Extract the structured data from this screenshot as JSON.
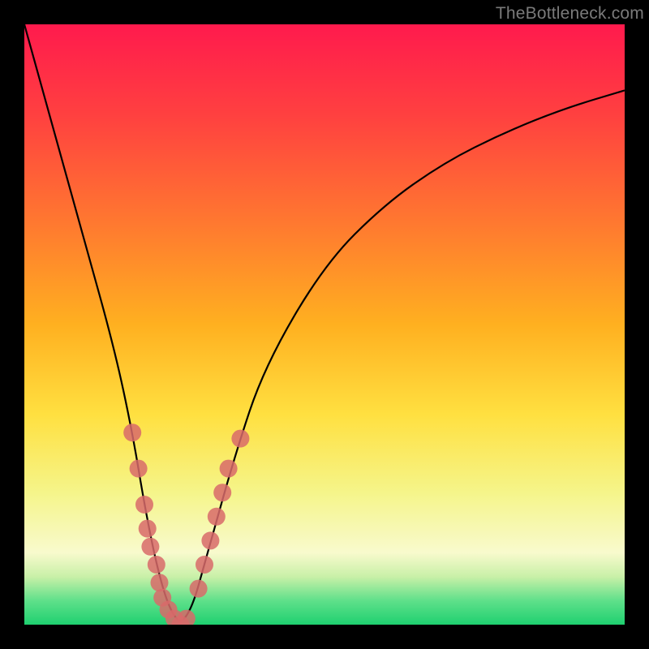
{
  "watermark": "TheBottleneck.com",
  "chart_data": {
    "type": "line",
    "title": "",
    "xlabel": "",
    "ylabel": "",
    "xlim": [
      0,
      100
    ],
    "ylim": [
      0,
      100
    ],
    "grid": false,
    "series": [
      {
        "name": "bottleneck-curve",
        "x": [
          0,
          5,
          10,
          15,
          18,
          20,
          22,
          24,
          26,
          28,
          30,
          35,
          40,
          50,
          60,
          70,
          80,
          90,
          100
        ],
        "values": [
          100,
          82,
          64,
          46,
          32,
          20,
          10,
          3,
          0,
          3,
          10,
          28,
          43,
          60,
          70,
          77,
          82,
          86,
          89
        ]
      }
    ],
    "markers": {
      "name": "highlighted-points",
      "color": "#d86a6a",
      "points": [
        {
          "x": 18,
          "y": 32
        },
        {
          "x": 19,
          "y": 26
        },
        {
          "x": 20,
          "y": 20
        },
        {
          "x": 20.5,
          "y": 16
        },
        {
          "x": 21,
          "y": 13
        },
        {
          "x": 22,
          "y": 10
        },
        {
          "x": 22.5,
          "y": 7
        },
        {
          "x": 23,
          "y": 4.5
        },
        {
          "x": 24,
          "y": 2.5
        },
        {
          "x": 25,
          "y": 1
        },
        {
          "x": 26,
          "y": 0
        },
        {
          "x": 27,
          "y": 1
        },
        {
          "x": 29,
          "y": 6
        },
        {
          "x": 30,
          "y": 10
        },
        {
          "x": 31,
          "y": 14
        },
        {
          "x": 32,
          "y": 18
        },
        {
          "x": 33,
          "y": 22
        },
        {
          "x": 34,
          "y": 26
        },
        {
          "x": 36,
          "y": 31
        }
      ]
    },
    "background_gradient": {
      "top": "#ff1a4d",
      "bottom": "#1fd070"
    }
  }
}
